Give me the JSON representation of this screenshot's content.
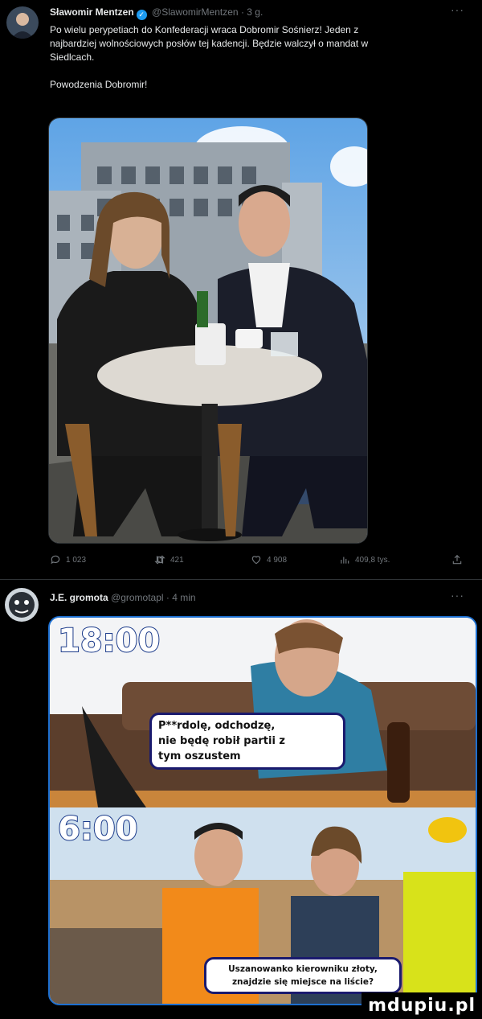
{
  "tweet1": {
    "author_name": "Sławomir Mentzen",
    "handle": "@SlawomirMentzen",
    "time": "3 g.",
    "text_line1": "Po wielu perypetiach do Konfederacji wraca Dobromir Sośnierz! Jeden z",
    "text_line2": "najbardziej wolnościowych posłów tej kadencji. Będzie walczył o mandat w",
    "text_line3": "Siedlcach.",
    "text_line4": "Powodzenia Dobromir!",
    "replies": "1 023",
    "retweets": "421",
    "likes": "4 908",
    "views": "409,8 tys."
  },
  "tweet2": {
    "author_name": "J.E. gromota",
    "handle": "@gromotapl",
    "time": "4 min",
    "meme": {
      "top_time": "18:00",
      "top_bubble_line1": "P**rdolę, odchodzę,",
      "top_bubble_line2": "nie będę robił partii z",
      "top_bubble_line3": "tym oszustem",
      "bottom_time": "6:00",
      "bottom_bubble_line1": "Uszanowanko kierowniku złoty,",
      "bottom_bubble_line2": "znajdzie się miejsce na liście?"
    }
  },
  "watermark": "mdupiu.pl",
  "colors": {
    "accent": "#1d9bf0",
    "muted": "#71767b",
    "divider": "#2f3336"
  }
}
